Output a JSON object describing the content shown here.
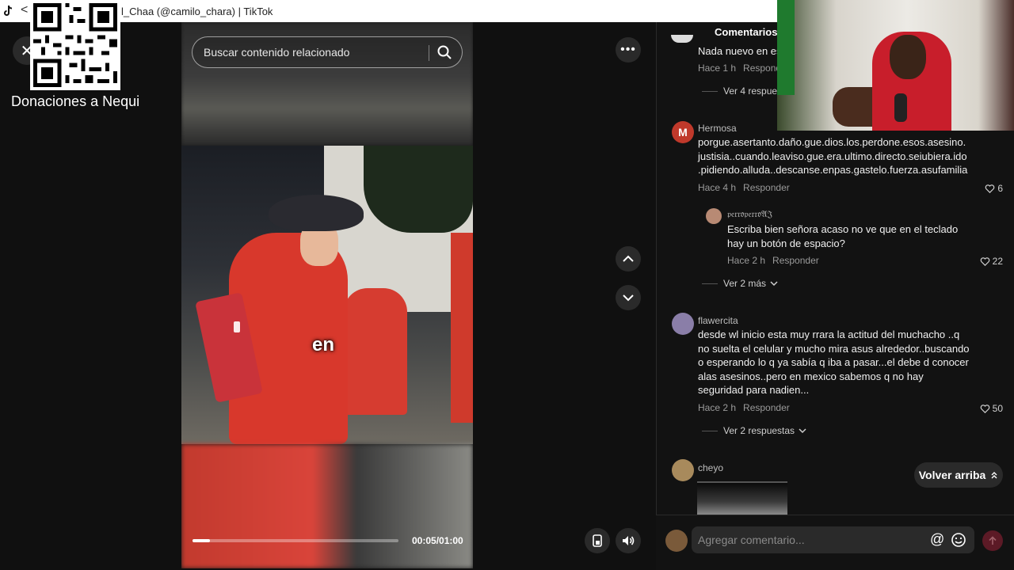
{
  "window": {
    "title": "l_Chaa (@camilo_chara) | TikTok",
    "back_glyph": "<"
  },
  "overlay": {
    "donation_label": "Donaciones a Nequi"
  },
  "player": {
    "close_glyph": "✕",
    "search_placeholder": "Buscar contenido relacionado",
    "more_glyph": "•••",
    "caption_word": "en",
    "time": "00:05/01:00",
    "progress": 0.0833
  },
  "comments_panel": {
    "header": "Comentarios (",
    "top_partial": {
      "text": "Nada nuevo en es",
      "time": "Hace 1 h",
      "reply_label": "Responder",
      "more_replies": "Ver 4 respue"
    },
    "comments": [
      {
        "author": "Hermosa",
        "avatar_letter": "M",
        "avatar_color": "#c0392b",
        "text": "porgue.asertanto.daño.gue.dios.los.perdone.esos.asesino.\njustisia..cuando.leaviso.gue.era.ultimo.directo.seiubiera.ido\n.pidiendo.alluda..descanse.enpas.gastelo.fuerza.asufamilia",
        "time": "Hace 4 h",
        "reply_label": "Responder",
        "likes": "6",
        "reply": {
          "author": "𝔭𝔢𝔯𝔯𝔬𝔭𝔢𝔯𝔯𝔬𝔄𝔍",
          "text": "Escriba bien señora acaso no ve que en el teclado\nhay un botón de espacio?",
          "time": "Hace 2 h",
          "reply_label": "Responder",
          "likes": "22"
        },
        "more_replies": "Ver 2 más"
      },
      {
        "author": "flawercita",
        "text": "desde wl inicio esta muy rrara la actitud del muchacho ..q\nno suelta el celular y mucho mira asus alrededor..buscando\no esperando lo q ya sabía q iba a pasar...el debe d conocer\nalas asesinos..pero en mexico sabemos q no hay\nseguridad para nadien...",
        "time": "Hace 2 h",
        "reply_label": "Responder",
        "likes": "50",
        "more_replies": "Ver 2 respuestas"
      },
      {
        "author": "cheyo"
      }
    ],
    "back_to_top": "Volver arriba",
    "comment_placeholder": "Agregar comentario...",
    "at_glyph": "@"
  },
  "colors": {
    "accent_send": "#5c1a26",
    "background": "#121212"
  },
  "icons": [
    "tiktok-icon",
    "close-icon",
    "qr-code",
    "search-icon",
    "more-icon",
    "chevron-up-icon",
    "chevron-down-icon",
    "device-icon",
    "volume-icon",
    "heart-icon",
    "emoji-icon",
    "send-icon"
  ]
}
